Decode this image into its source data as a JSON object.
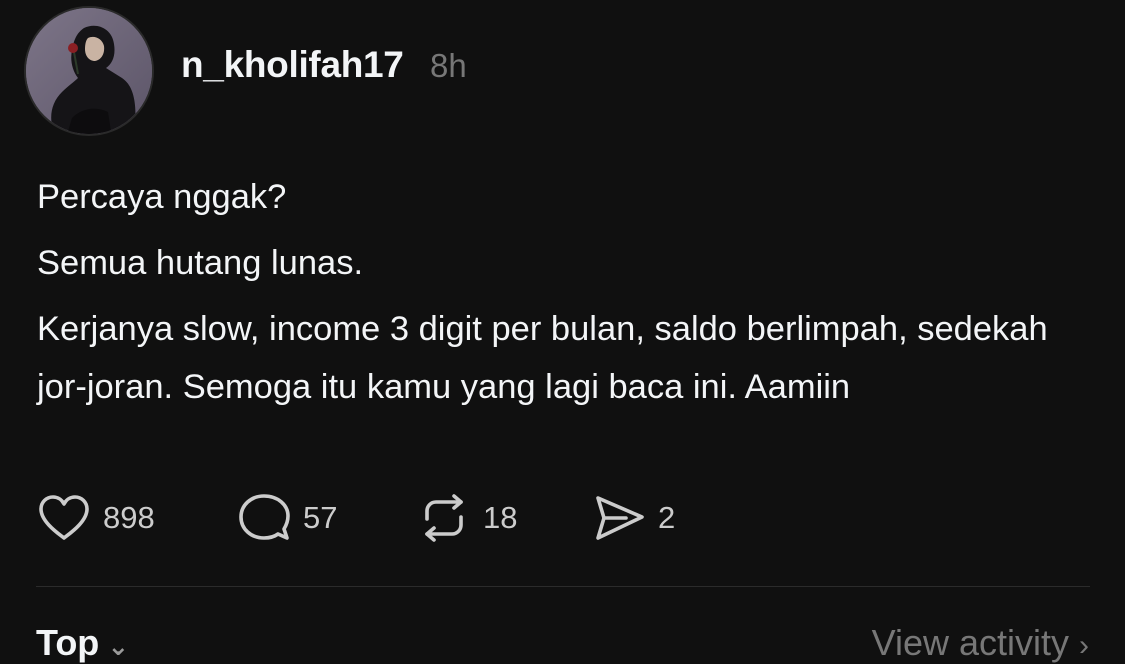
{
  "post": {
    "username": "n_kholifah17",
    "timestamp": "8h",
    "lines": [
      "Percaya nggak?",
      "Semua hutang lunas.",
      "Kerjanya slow, income 3 digit per bulan, saldo berlimpah, sedekah jor-joran. Semoga itu kamu yang lagi baca ini. Aamiin"
    ]
  },
  "actions": {
    "likes": "898",
    "comments": "57",
    "reposts": "18",
    "shares": "2"
  },
  "footer": {
    "sort_label": "Top",
    "activity_label": "View activity"
  },
  "icons": {
    "like": "heart-icon",
    "comment": "comment-bubble-icon",
    "repost": "repost-icon",
    "share": "send-icon",
    "chevron": "chevron-down-icon"
  },
  "colors": {
    "background": "#101010",
    "text": "#f3f5f7",
    "muted": "#777777"
  }
}
